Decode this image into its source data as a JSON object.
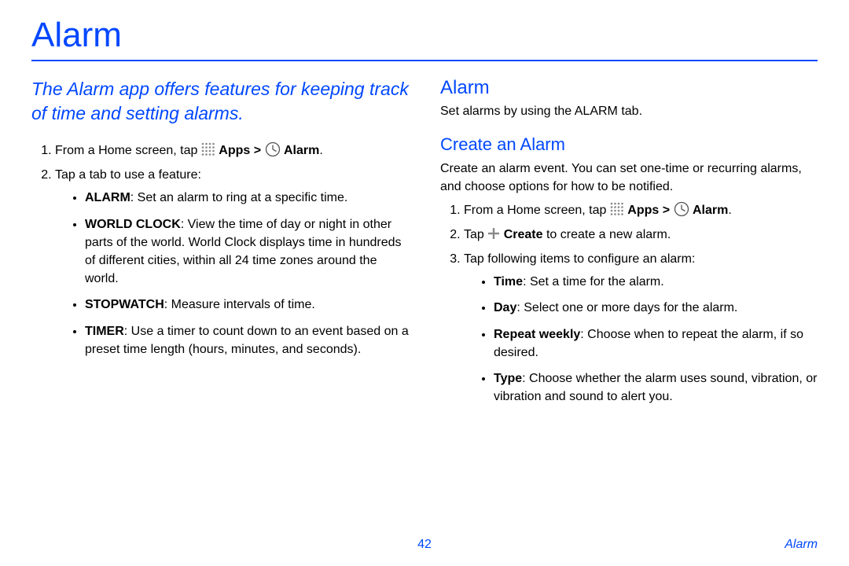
{
  "pageTitle": "Alarm",
  "intro": "The Alarm app offers features for keeping track of time and setting alarms.",
  "left": {
    "step1_a": "From a Home screen, tap ",
    "apps_label": "Apps",
    "gt": " > ",
    "alarm_label": "Alarm",
    "period": ".",
    "step2": "Tap a tab to use a feature:",
    "features": {
      "alarm_name": "ALARM",
      "alarm_desc": ": Set an alarm to ring at a specific time.",
      "world_name": "WORLD CLOCK",
      "world_desc": ": View the time of day or night in other parts of the world. World Clock displays time in hundreds of different cities, within all 24 time zones around the world.",
      "stopwatch_name": "STOPWATCH",
      "stopwatch_desc": ": Measure intervals of time.",
      "timer_name": "TIMER",
      "timer_desc": ": Use a timer to count down to an event based on a preset time length (hours, minutes, and seconds)."
    }
  },
  "right": {
    "heading": "Alarm",
    "heading_desc": "Set alarms by using the ALARM tab.",
    "sub_heading": "Create an Alarm",
    "sub_intro": "Create an alarm event. You can set one-time or recurring alarms, and choose options for how to be notified.",
    "step1_a": "From a Home screen, tap ",
    "apps_label": "Apps",
    "gt": " > ",
    "alarm_label": "Alarm",
    "period": ".",
    "step2_a": "Tap ",
    "create_label": "Create",
    "step2_b": " to create a new alarm.",
    "step3": "Tap following items to configure an alarm:",
    "opts": {
      "time_name": "Time",
      "time_desc": ": Set a time for the alarm.",
      "day_name": "Day",
      "day_desc": ": Select one or more days for the alarm.",
      "repeat_name": "Repeat weekly",
      "repeat_desc": ": Choose when to repeat the alarm, if so desired.",
      "type_name": "Type",
      "type_desc": ": Choose whether the alarm uses sound, vibration, or vibration and sound to alert you."
    }
  },
  "footer": {
    "pageNumber": "42",
    "section": "Alarm"
  }
}
